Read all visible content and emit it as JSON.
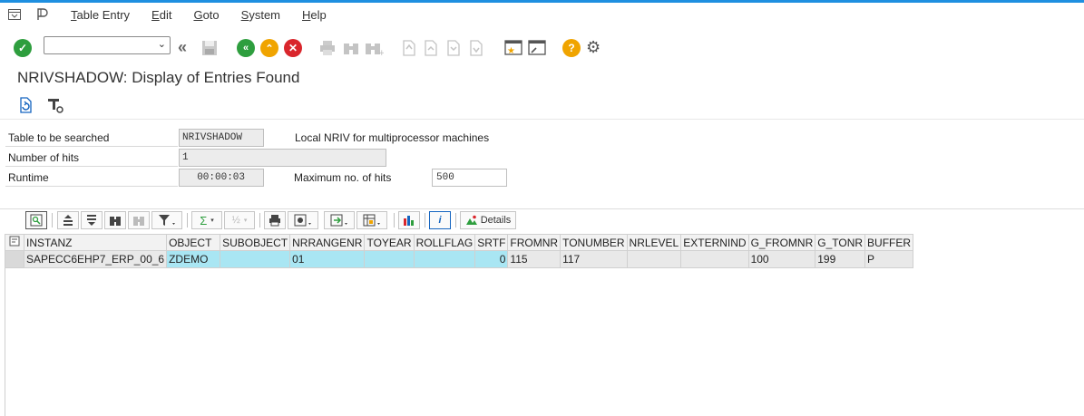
{
  "menu": {
    "items": [
      {
        "label": "Table Entry",
        "underline": "T",
        "rest": "able Entry"
      },
      {
        "label": "Edit",
        "underline": "E",
        "rest": "dit"
      },
      {
        "label": "Goto",
        "underline": "G",
        "rest": "oto"
      },
      {
        "label": "System",
        "underline": "S",
        "rest": "ystem"
      },
      {
        "label": "Help",
        "underline": "H",
        "rest": "elp"
      }
    ]
  },
  "toolbar": {
    "command_field_value": "",
    "colors": {
      "enter": "#2e9e3e",
      "back": "#2e9e3e",
      "exit": "#f0a400",
      "cancel": "#d9262c",
      "help": "#f0a400"
    }
  },
  "page": {
    "title": "NRIVSHADOW: Display of Entries Found"
  },
  "search": {
    "table_label": "Table to be searched",
    "table_value": "NRIVSHADOW",
    "table_description": "Local NRIV for multiprocessor machines",
    "hits_label": "Number of hits",
    "hits_value": "1",
    "runtime_label": "Runtime",
    "runtime_value": "00:00:03",
    "max_hits_label": "Maximum no. of hits",
    "max_hits_value": "500"
  },
  "alv": {
    "details_label": "Details"
  },
  "grid": {
    "columns": [
      "INSTANZ",
      "OBJECT",
      "SUBOBJECT",
      "NRRANGENR",
      "TOYEAR",
      "ROLLFLAG",
      "SRTF",
      "FROMNR",
      "TONUMBER",
      "NRLEVEL",
      "EXTERNIND",
      "G_FROMNR",
      "G_TONR",
      "BUFFER"
    ],
    "rows": [
      {
        "INSTANZ": "SAPECC6EHP7_ERP_00_6",
        "OBJECT": "ZDEMO",
        "SUBOBJECT": "",
        "NRRANGENR": "01",
        "TOYEAR": "",
        "ROLLFLAG": "",
        "SRTF": "0",
        "FROMNR": "115",
        "TONUMBER": "117",
        "NRLEVEL": "",
        "EXTERNIND": "",
        "G_FROMNR": "100",
        "G_TONR": "199",
        "BUFFER": "P"
      }
    ]
  }
}
